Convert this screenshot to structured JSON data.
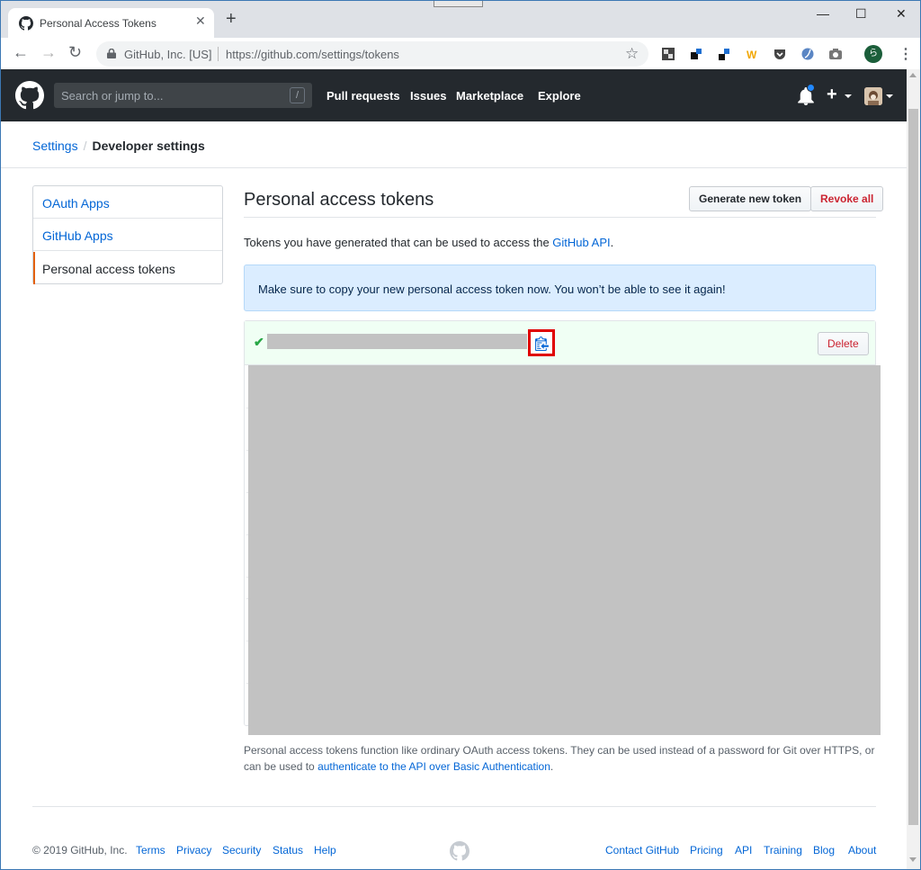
{
  "browser": {
    "tab_title": "Personal Access Tokens",
    "new_tab_symbol": "+",
    "security_label": "GitHub, Inc. [US]",
    "url": "https://github.com/settings/tokens",
    "profile_initial": "ら"
  },
  "header": {
    "search_placeholder": "Search or jump to...",
    "search_shortcut": "/",
    "nav": [
      "Pull requests",
      "Issues",
      "Marketplace",
      "Explore"
    ],
    "plus_symbol": "+"
  },
  "breadcrumb": {
    "parent": "Settings",
    "separator": "/",
    "current": "Developer settings"
  },
  "sidebar": {
    "items": [
      {
        "label": "OAuth Apps"
      },
      {
        "label": "GitHub Apps"
      },
      {
        "label": "Personal access tokens",
        "selected": true
      }
    ]
  },
  "main": {
    "title": "Personal access tokens",
    "generate_button": "Generate new token",
    "revoke_button": "Revoke all",
    "intro_text": "Tokens you have generated that can be used to access the ",
    "intro_link": "GitHub API",
    "intro_end": ".",
    "flash": "Make sure to copy your new personal access token now. You won’t be able to see it again!",
    "token_check": "✔",
    "delete_button": "Delete",
    "footnote_text": "Personal access tokens function like ordinary OAuth access tokens. They can be used instead of a password for Git over HTTPS, or can be used to ",
    "footnote_link": "authenticate to the API over Basic Authentication",
    "footnote_end": "."
  },
  "footer": {
    "copyright": "© 2019 GitHub, Inc.",
    "left_links": [
      "Terms",
      "Privacy",
      "Security",
      "Status",
      "Help"
    ],
    "right_links": [
      "Contact GitHub",
      "Pricing",
      "API",
      "Training",
      "Blog",
      "About"
    ]
  },
  "colors": {
    "header_bg": "#24292e",
    "link": "#0366d6",
    "danger": "#cb2431",
    "success": "#28a745",
    "selected_accent": "#e36209",
    "flash_bg": "#dbedff",
    "highlight_box": "#e00000"
  },
  "icons": {
    "tab": "github-mark-icon",
    "copy": "clippy-icon",
    "notifications": "bell-icon"
  }
}
